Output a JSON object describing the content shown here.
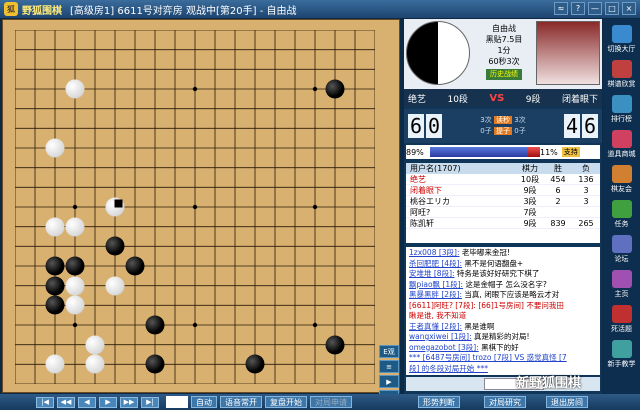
{
  "titlebar": {
    "app_name": "野狐围棋",
    "room": "[高级房1]",
    "game": "6611号对弈房 观战中[第20手] - 自由战"
  },
  "window_buttons": [
    "≈",
    "?",
    "—",
    "□",
    "×"
  ],
  "board": {
    "size": 19,
    "black_stones": [
      [
        16,
        3
      ],
      [
        5,
        11
      ],
      [
        2,
        12
      ],
      [
        3,
        12
      ],
      [
        6,
        12
      ],
      [
        2,
        13
      ],
      [
        2,
        14
      ],
      [
        7,
        15
      ],
      [
        7,
        17
      ],
      [
        12,
        17
      ],
      [
        16,
        16
      ]
    ],
    "white_stones": [
      [
        3,
        3
      ],
      [
        2,
        6
      ],
      [
        2,
        10
      ],
      [
        3,
        10
      ],
      [
        3,
        13
      ],
      [
        5,
        13
      ],
      [
        3,
        14
      ],
      [
        4,
        16
      ],
      [
        4,
        17
      ],
      [
        2,
        17
      ]
    ],
    "last_move": [
      5,
      9
    ]
  },
  "side_buttons": [
    "E观",
    "≡",
    "▶",
    "●"
  ],
  "bottom_controls": {
    "nav_buttons": [
      "|◀",
      "◀◀",
      "◀",
      "▶",
      "▶▶",
      "▶|"
    ],
    "auto_label": "自动",
    "voice_label": "语音常开",
    "review_label": "复盘开始",
    "request_label": "对局申请"
  },
  "players": {
    "game_type": "自由战",
    "komi": "黑贴7.5目",
    "time": "1分",
    "byoyomi": "60秒3次",
    "history_label": "历史战绩",
    "black_name": "绝艺",
    "black_rank": "10段",
    "white_name": "闭着眼下",
    "white_rank": "9段",
    "vs": "VS"
  },
  "timer": {
    "black_digits": [
      "6",
      "0"
    ],
    "white_digits": [
      "4",
      "6"
    ],
    "black_byoyomi": "3次",
    "white_byoyomi": "3次",
    "countdown_label": "读秒",
    "black_captures": "0子",
    "white_captures": "0子",
    "captures_label": "提子"
  },
  "winrate": {
    "black_pct": "89%",
    "white_pct": "11%",
    "black_value": 0.89,
    "support_label": "支持"
  },
  "users": {
    "header": [
      "用户名(1707)",
      "",
      "棋力",
      "胜",
      "负"
    ],
    "rows": [
      [
        "绝艺",
        "",
        "10段",
        "454",
        "136"
      ],
      [
        "闭着眼下",
        "",
        "9段",
        "6",
        "3"
      ],
      [
        "桃谷エリカ",
        "",
        "3段",
        "2",
        "3"
      ],
      [
        "阿旺?",
        "",
        "7段",
        "",
        ""
      ],
      [
        "陈凯轩",
        "",
        "9段",
        "839",
        "265"
      ]
    ]
  },
  "chat": [
    {
      "name": "1zx008 [3段]:",
      "msg": " 老毕嘟来金冠!"
    },
    {
      "name": "杀回肥肥 [4段]:",
      "msg": " 黑不是何语翻盘+"
    },
    {
      "name": "安堆堆 [8段]:",
      "msg": " 特务是该好好研究下棋了"
    },
    {
      "name": "飘piao飘 [1段]:",
      "msg": " 这是金帽子 怎么没名字?"
    },
    {
      "name": "黑暴黑胖 [2段]:",
      "msg": " 当真, 闭眼下应该是略云才对"
    },
    {
      "name": "[6611]阿旺? [7段]:",
      "msg": " [66]1号房间] 不要问我田",
      "red": true
    },
    {
      "name": "瞅是谁, 我不知道",
      "msg": "",
      "red": true
    },
    {
      "name": "王者真懂 [2段]:",
      "msg": " 黑是谁啊"
    },
    {
      "name": "wangxiwei [1段]:",
      "msg": " 真是精彩的对局!"
    },
    {
      "name": "omegazobot [3段]:",
      "msg": " 黑棋下的好"
    },
    {
      "name": "*** [6487号房间] trozo [7段] VS 惑觉真怪 [7",
      "msg": ""
    },
    {
      "name": "段] 的冬段对局开始 ***",
      "msg": ""
    }
  ],
  "bottom_tabs": [
    "形势判断",
    "对局研究",
    "退出房间"
  ],
  "watermark": "新野狐围棋",
  "right_menu": [
    "切换大厅",
    "棋谱欣赏",
    "排行榜",
    "道具商城",
    "棋友会",
    "任务",
    "论坛",
    "主页",
    "死活题",
    "新手教学"
  ]
}
